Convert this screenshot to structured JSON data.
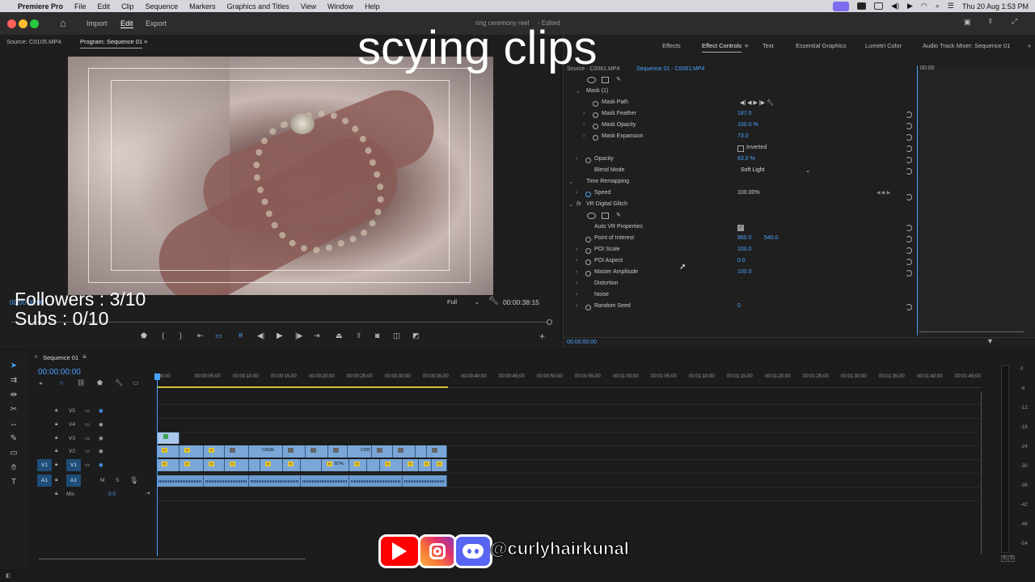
{
  "menubar": {
    "app": "Premiere Pro",
    "items": [
      "File",
      "Edit",
      "Clip",
      "Sequence",
      "Markers",
      "Graphics and Titles",
      "View",
      "Window",
      "Help"
    ],
    "datetime": "Thu 20 Aug  1:53 PM"
  },
  "titlebar": {
    "import": "Import",
    "edit": "Edit",
    "export": "Export",
    "doc_title": "ring ceremony reel",
    "doc_status": "- Edited"
  },
  "source_monitor": {
    "tab_source": "Source: C0105.MP4",
    "tab_program": "Program: Sequence 01",
    "zoom": "Full",
    "duration": "00:00:38:15",
    "timecode": "00:00:00:00"
  },
  "effect_panel": {
    "tabs": [
      "Effects",
      "Effect Controls",
      "Text",
      "Essential Graphics",
      "Lumetri Color",
      "Audio Track Mixer: Sequence 01"
    ],
    "active_tab": "Effect Controls",
    "source_label": "Source · C0061.MP4",
    "sequence_label": "Sequence 01 - C0061.MP4",
    "ruler_time": "00:00",
    "footer_time": "00:00:00:00",
    "rows": {
      "mask": "Mask (1)",
      "mask_path": "Mask Path",
      "mask_feather": "Mask Feather",
      "mask_feather_val": "187.0",
      "mask_opacity": "Mask Opacity",
      "mask_opacity_val": "100.0 %",
      "mask_expansion": "Mask Expansion",
      "mask_expansion_val": "73.0",
      "inverted": "Inverted",
      "opacity": "Opacity",
      "opacity_val": "63.0 %",
      "blend_mode": "Blend Mode",
      "blend_mode_val": "Soft Light",
      "time_remapping": "Time Remapping",
      "speed": "Speed",
      "speed_val": "100.00%",
      "vr_glitch": "VR Digital Glitch",
      "auto_vr": "Auto VR Properties",
      "poi": "Point of Interest",
      "poi_x": "960.0",
      "poi_y": "540.0",
      "poi_scale": "POI Scale",
      "poi_scale_val": "100.0",
      "poi_aspect": "POI Aspect",
      "poi_aspect_val": "0.0",
      "master_amp": "Master Amplitude",
      "master_amp_val": "100.0",
      "distortion": "Distortion",
      "noise": "Noise",
      "random_seed": "Random Seed",
      "random_seed_val": "0"
    }
  },
  "timeline": {
    "tab": "Sequence 01",
    "timecode": "00:00:00:00",
    "ruler": [
      ":00:00",
      "00:00:05:00",
      "00:00:10:00",
      "00:00:15:00",
      "00:00:20:00",
      "00:00:25:00",
      "00:00:30:00",
      "00:00:35:00",
      "00:00:40:00",
      "00:00:45:00",
      "00:00:50:00",
      "00:00:55:00",
      "00:01:00:00",
      "00:01:05:00",
      "00:01:10:00",
      "00:01:15:00",
      "00:01:20:00",
      "00:01:25:00",
      "00:01:30:00",
      "00:01:35:00",
      "00:01:40:00",
      "00:01:45:00"
    ],
    "tracks": [
      "V5",
      "V4",
      "V3",
      "V2",
      "V1",
      "A1"
    ],
    "v1_src": "V1",
    "a1_src": "A1",
    "mix_label": "Mix",
    "mix_val": "0.0",
    "m": "M",
    "s": "S",
    "clip_names": [
      "C0036.",
      "C005",
      "B74c"
    ]
  },
  "meter": {
    "labels": [
      "0",
      "-6",
      "-12",
      "-18",
      "-24",
      "-30",
      "-36",
      "-42",
      "-48",
      "-54"
    ],
    "s1": "S",
    "s2": "S"
  },
  "overlay": {
    "title": "scying clips",
    "followers": "Followers : 3/10",
    "subs": "Subs : 0/10",
    "handle": "@curlyhairkunal"
  },
  "colors": {
    "accent_blue": "#4aa3ff",
    "clip_blue": "#7aa7d8",
    "fx_yellow": "#e5c42d",
    "youtube_red": "#ff0000",
    "discord": "#5865f2"
  }
}
